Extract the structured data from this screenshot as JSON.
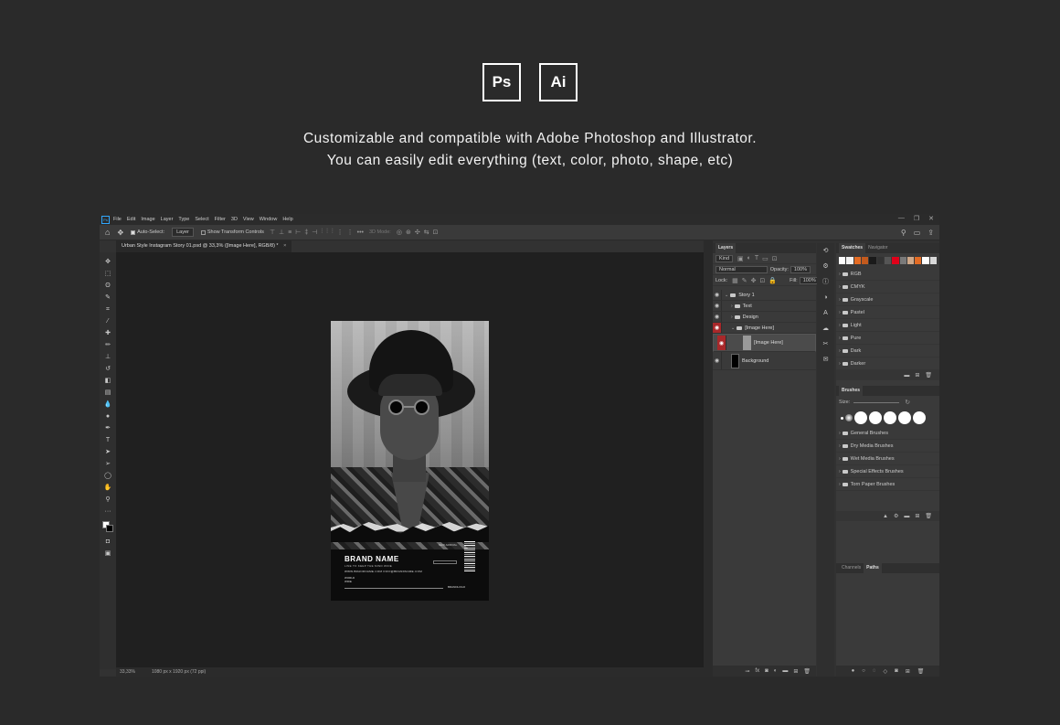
{
  "header": {
    "badges": [
      "Ps",
      "Ai"
    ],
    "line1": "Customizable and compatible with Adobe Photoshop and Illustrator.",
    "line2": "You can easily edit everything (text, color, photo, shape, etc)"
  },
  "menu": {
    "logo": "Ps",
    "items": [
      "File",
      "Edit",
      "Image",
      "Layer",
      "Type",
      "Select",
      "Filter",
      "3D",
      "View",
      "Window",
      "Help"
    ],
    "window_controls": [
      "—",
      "❐",
      "✕"
    ]
  },
  "options": {
    "auto_select": "Auto-Select:",
    "auto_select_target": "Layer",
    "transform_controls": "Show Transform Controls",
    "mode_3d": "3D Mode:"
  },
  "document": {
    "tab_title": "Urban Style Instagram Story 01.psd @ 33,3% ([Image Here], RGB/8) *",
    "close": "×"
  },
  "status": {
    "zoom": "33,33%",
    "doc_size": "1080 px x 1920 px (72 ppi)"
  },
  "artboard": {
    "brand_name": "BRAND NAME",
    "subtitle": "LINE TO KEEP THE MIND WIDE",
    "info_line": "WWW.BRANDNAME.COM   INFO@BRANDNAME.COM",
    "small1": "WORLD",
    "small2": "WIDE",
    "top_right": "NEW ARRIVAL",
    "logo": "BRANDLOGO"
  },
  "layers_panel": {
    "title": "Layers",
    "filter": "Kind",
    "blend_mode": "Normal",
    "opacity_label": "Opacity:",
    "opacity_value": "100%",
    "lock_label": "Lock:",
    "fill_label": "Fill:",
    "fill_value": "100%",
    "layers": [
      {
        "name": "Story 1",
        "type": "group"
      },
      {
        "name": "Text",
        "type": "group"
      },
      {
        "name": "Design",
        "type": "group"
      },
      {
        "name": "[Image Here]",
        "type": "group"
      },
      {
        "name": "[Image Here]",
        "type": "smart"
      },
      {
        "name": "Background",
        "type": "fill"
      }
    ]
  },
  "swatches_panel": {
    "tabs": [
      "Swatches",
      "Navigator"
    ],
    "colors": [
      "#ffffff",
      "#f2f2f2",
      "#e46c24",
      "#c35a1e",
      "#1a1a1a",
      "#333333",
      "#555555",
      "#e0001a",
      "#7a7a7a",
      "#cfa98a",
      "#e46c24",
      "#ffffff",
      "#d9d9d9"
    ],
    "groups": [
      "RGB",
      "CMYK",
      "Grayscale",
      "Pastel",
      "Light",
      "Pure",
      "Dark",
      "Darker"
    ]
  },
  "brushes_panel": {
    "title": "Brushes",
    "size_label": "Size:",
    "groups": [
      "General Brushes",
      "Dry Media Brushes",
      "Wet Media Brushes",
      "Special Effects Brushes",
      "Torn Paper Brushes"
    ]
  },
  "channels_panel": {
    "tabs": [
      "Channels",
      "Paths"
    ]
  }
}
